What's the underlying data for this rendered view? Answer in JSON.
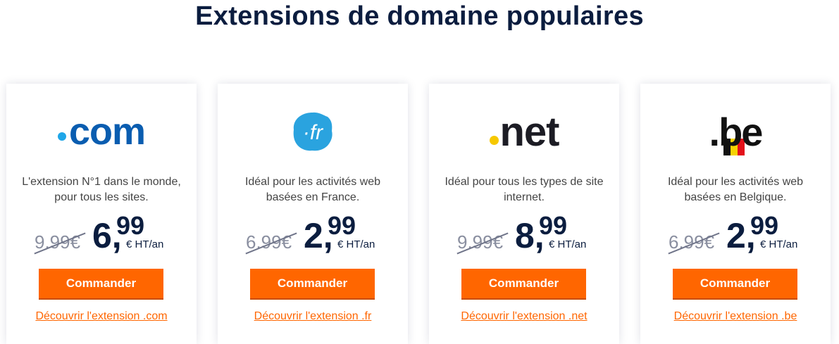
{
  "page": {
    "title": "Extensions de domaine populaires"
  },
  "colors": {
    "accent": "#ff6600",
    "title": "#0b1d3f",
    "com_blue": "#0a5db0",
    "net_yellow": "#f6c800"
  },
  "cards": [
    {
      "logo_text": ".com",
      "icon": "com-logo",
      "description": "L'extension N°1 dans le monde, pour tous les sites.",
      "old_price": "9.99€",
      "price_int": "6,",
      "price_cents": "99",
      "price_unit": "€ HT/an",
      "order_label": "Commander",
      "discover_label": "Découvrir l'extension .com"
    },
    {
      "logo_text": "·fr",
      "icon": "fr-logo",
      "description": "Idéal pour les activités web basées en France.",
      "old_price": "6.99€",
      "price_int": "2,",
      "price_cents": "99",
      "price_unit": "€ HT/an",
      "order_label": "Commander",
      "discover_label": "Découvrir l'extension .fr"
    },
    {
      "logo_text": ".net",
      "icon": "net-logo",
      "description": "Idéal pour tous les types de site internet.",
      "old_price": "9.99€",
      "price_int": "8,",
      "price_cents": "99",
      "price_unit": "€ HT/an",
      "order_label": "Commander",
      "discover_label": "Découvrir l'extension .net"
    },
    {
      "logo_text": ".be",
      "icon": "be-logo",
      "description": "Idéal pour les activités web basées en Belgique.",
      "old_price": "6.99€",
      "price_int": "2,",
      "price_cents": "99",
      "price_unit": "€ HT/an",
      "order_label": "Commander",
      "discover_label": "Découvrir l'extension .be"
    }
  ]
}
